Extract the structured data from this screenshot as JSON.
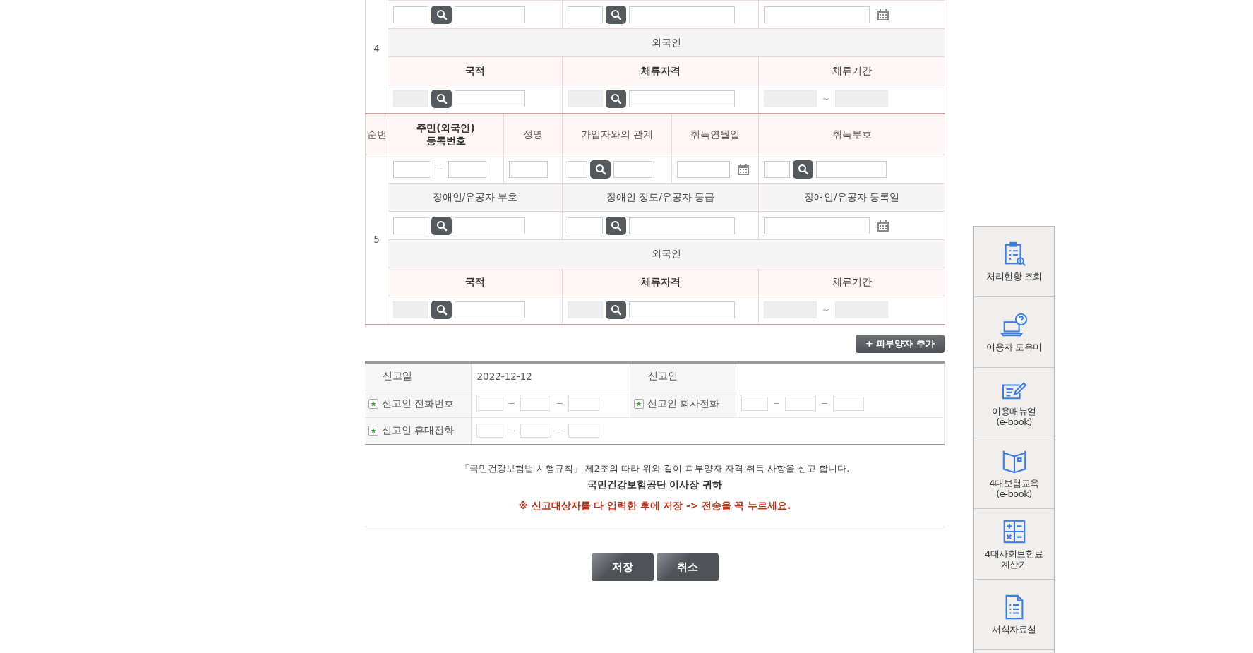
{
  "dependents": [
    {
      "number": "4",
      "details": {
        "inputs": [
          {
            "kind": "code",
            "disabled": false
          },
          {
            "kind": "code",
            "disabled": false
          },
          {
            "kind": "date",
            "disabled": false
          }
        ]
      },
      "foreign": {
        "label": "외국인",
        "headers": [
          "국적",
          "체류자격",
          "체류기간"
        ],
        "inputs": [
          {
            "kind": "code",
            "disabled": true
          },
          {
            "kind": "code",
            "disabled": true
          },
          {
            "kind": "period",
            "disabled": true
          }
        ]
      }
    },
    {
      "number": "5",
      "header": {
        "seq": "순번",
        "columns": [
          "주민(외국인)\n등록번호",
          "성명",
          "가입자와의 관계",
          "취득연월일",
          "취득부호"
        ]
      },
      "main_inputs": [
        {
          "kind": "rrn",
          "disabled": false
        },
        {
          "kind": "text",
          "disabled": false
        },
        {
          "kind": "code",
          "disabled": false
        },
        {
          "kind": "date",
          "disabled": false
        },
        {
          "kind": "code",
          "disabled": false
        }
      ],
      "details": {
        "headers": [
          "장애인/유공자 부호",
          "장애인 정도/유공자 등급",
          "장애인/유공자 등록일"
        ],
        "inputs": [
          {
            "kind": "code",
            "disabled": false
          },
          {
            "kind": "code",
            "disabled": false
          },
          {
            "kind": "date",
            "disabled": false
          }
        ]
      },
      "foreign": {
        "label": "외국인",
        "headers": [
          "국적",
          "체류자격",
          "체류기간"
        ],
        "inputs": [
          {
            "kind": "code",
            "disabled": true
          },
          {
            "kind": "code",
            "disabled": true
          },
          {
            "kind": "period",
            "disabled": true
          }
        ]
      }
    }
  ],
  "add_button": "+ 피부양자 추가",
  "reporter": [
    [
      {
        "label": "신고일",
        "required": false,
        "kind": "text",
        "value": "2022-12-12"
      },
      {
        "label": "신고인",
        "required": false,
        "kind": "empty"
      }
    ],
    [
      {
        "label": "신고인 전화번호",
        "required": true,
        "kind": "phone"
      },
      {
        "label": "신고인 회사전화",
        "required": true,
        "kind": "phone"
      }
    ],
    [
      {
        "label": "신고인 휴대전화",
        "required": true,
        "kind": "phone"
      }
    ]
  ],
  "notice": {
    "statement": "「국민건강보험법 시행규칙」 제2조의 따라 위와 같이 피부양자 자격 취득 사항을 신고 합니다.",
    "addressee": "국민건강보험공단 이사장 귀하",
    "warning": "※ 신고대상자를 다 입력한 후에 저장 -> 전송을 꼭 누르세요."
  },
  "buttons": [
    "저장",
    "취소"
  ],
  "quick_menu": [
    {
      "label": "처리현황 조회"
    },
    {
      "label": "이용자 도우미"
    },
    {
      "label": "이용매뉴얼\n(e-book)"
    },
    {
      "label": "4대보험교육\n(e-book)"
    },
    {
      "label": "4대사회보험료\n계산기"
    },
    {
      "label": "서식자료실"
    }
  ]
}
